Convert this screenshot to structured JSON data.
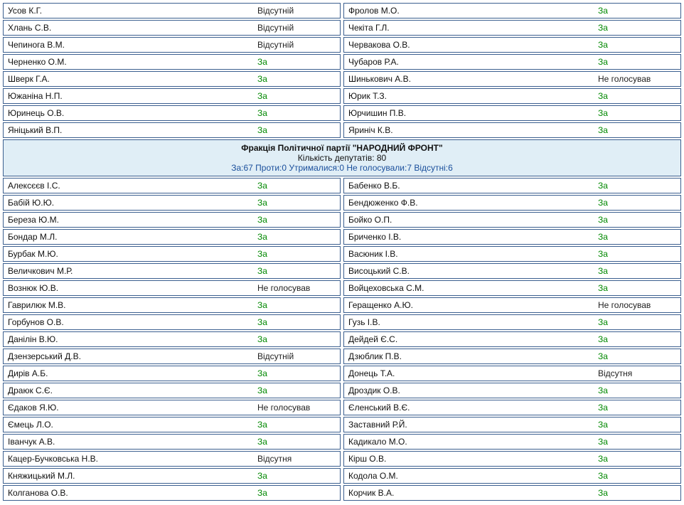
{
  "top_rows": [
    {
      "left": {
        "name": "Усов К.Г.",
        "vote": "Відсутній"
      },
      "right": {
        "name": "Фролов М.О.",
        "vote": "За"
      }
    },
    {
      "left": {
        "name": "Хлань С.В.",
        "vote": "Відсутній"
      },
      "right": {
        "name": "Чекіта Г.Л.",
        "vote": "За"
      }
    },
    {
      "left": {
        "name": "Чепинога В.М.",
        "vote": "Відсутній"
      },
      "right": {
        "name": "Червакова О.В.",
        "vote": "За"
      }
    },
    {
      "left": {
        "name": "Черненко О.М.",
        "vote": "За"
      },
      "right": {
        "name": "Чубаров Р.А.",
        "vote": "За"
      }
    },
    {
      "left": {
        "name": "Шверк Г.А.",
        "vote": "За"
      },
      "right": {
        "name": "Шинькович А.В.",
        "vote": "Не голосував"
      }
    },
    {
      "left": {
        "name": "Южаніна Н.П.",
        "vote": "За"
      },
      "right": {
        "name": "Юрик Т.З.",
        "vote": "За"
      }
    },
    {
      "left": {
        "name": "Юринець О.В.",
        "vote": "За"
      },
      "right": {
        "name": "Юрчишин П.В.",
        "vote": "За"
      }
    },
    {
      "left": {
        "name": "Яніцький В.П.",
        "vote": "За"
      },
      "right": {
        "name": "Яриніч К.В.",
        "vote": "За"
      }
    }
  ],
  "faction": {
    "title": "Фракція Політичної партії \"НАРОДНИЙ ФРОНТ\"",
    "count": "Кількість депутатів: 80",
    "tally": "За:67 Проти:0 Утрималися:0 Не голосували:7 Відсутні:6"
  },
  "bottom_rows": [
    {
      "left": {
        "name": "Алексєєв І.С.",
        "vote": "За"
      },
      "right": {
        "name": "Бабенко В.Б.",
        "vote": "За"
      }
    },
    {
      "left": {
        "name": "Бабій Ю.Ю.",
        "vote": "За"
      },
      "right": {
        "name": "Бендюженко Ф.В.",
        "vote": "За"
      }
    },
    {
      "left": {
        "name": "Береза Ю.М.",
        "vote": "За"
      },
      "right": {
        "name": "Бойко О.П.",
        "vote": "За"
      }
    },
    {
      "left": {
        "name": "Бондар М.Л.",
        "vote": "За"
      },
      "right": {
        "name": "Бриченко І.В.",
        "vote": "За"
      }
    },
    {
      "left": {
        "name": "Бурбак М.Ю.",
        "vote": "За"
      },
      "right": {
        "name": "Васюник І.В.",
        "vote": "За"
      }
    },
    {
      "left": {
        "name": "Величкович М.Р.",
        "vote": "За"
      },
      "right": {
        "name": "Висоцький С.В.",
        "vote": "За"
      }
    },
    {
      "left": {
        "name": "Вознюк Ю.В.",
        "vote": "Не голосував"
      },
      "right": {
        "name": "Войцеховська С.М.",
        "vote": "За"
      }
    },
    {
      "left": {
        "name": "Гаврилюк М.В.",
        "vote": "За"
      },
      "right": {
        "name": "Геращенко А.Ю.",
        "vote": "Не голосував"
      }
    },
    {
      "left": {
        "name": "Горбунов О.В.",
        "vote": "За"
      },
      "right": {
        "name": "Гузь І.В.",
        "vote": "За"
      }
    },
    {
      "left": {
        "name": "Данілін В.Ю.",
        "vote": "За"
      },
      "right": {
        "name": "Дейдей Є.С.",
        "vote": "За"
      }
    },
    {
      "left": {
        "name": "Дзензерський Д.В.",
        "vote": "Відсутній"
      },
      "right": {
        "name": "Дзюблик П.В.",
        "vote": "За"
      }
    },
    {
      "left": {
        "name": "Дирів А.Б.",
        "vote": "За"
      },
      "right": {
        "name": "Донець Т.А.",
        "vote": "Відсутня"
      }
    },
    {
      "left": {
        "name": "Драюк С.Є.",
        "vote": "За"
      },
      "right": {
        "name": "Дроздик О.В.",
        "vote": "За"
      }
    },
    {
      "left": {
        "name": "Єдаков Я.Ю.",
        "vote": "Не голосував"
      },
      "right": {
        "name": "Єленський В.Є.",
        "vote": "За"
      }
    },
    {
      "left": {
        "name": "Ємець Л.О.",
        "vote": "За"
      },
      "right": {
        "name": "Заставний Р.Й.",
        "vote": "За"
      }
    },
    {
      "left": {
        "name": "Іванчук А.В.",
        "vote": "За"
      },
      "right": {
        "name": "Кадикало М.О.",
        "vote": "За"
      }
    },
    {
      "left": {
        "name": "Кацер-Бучковська Н.В.",
        "vote": "Відсутня"
      },
      "right": {
        "name": "Кірш О.В.",
        "vote": "За"
      }
    },
    {
      "left": {
        "name": "Княжицький М.Л.",
        "vote": "За"
      },
      "right": {
        "name": "Кодола О.М.",
        "vote": "За"
      }
    },
    {
      "left": {
        "name": "Колганова О.В.",
        "vote": "За"
      },
      "right": {
        "name": "Корчик В.А.",
        "vote": "За"
      }
    }
  ]
}
